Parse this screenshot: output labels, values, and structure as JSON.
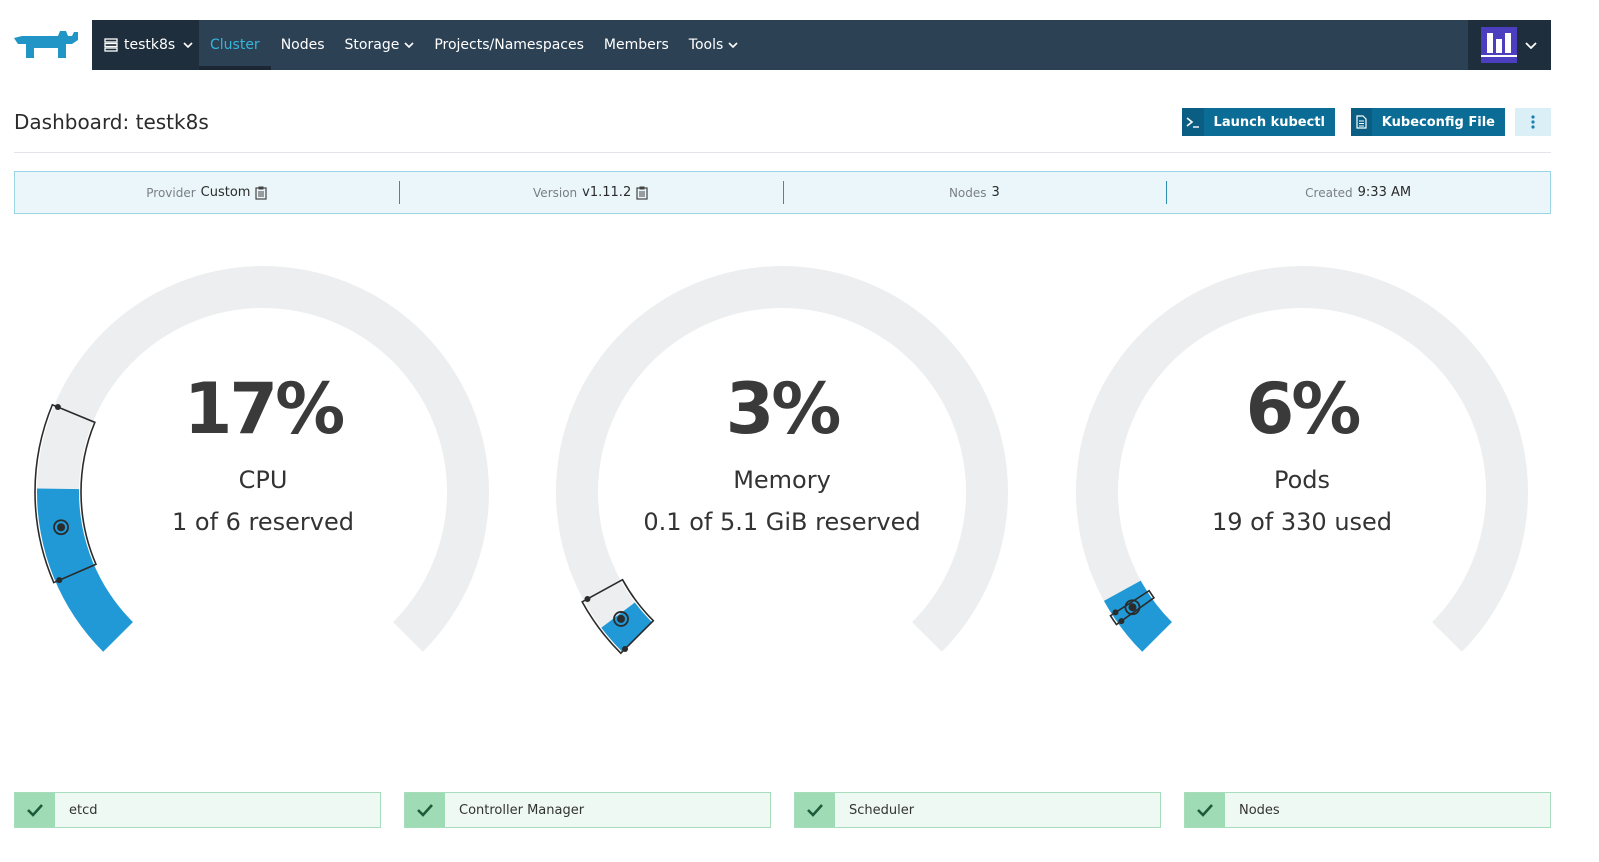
{
  "nav": {
    "cluster": "testk8s",
    "items": [
      {
        "label": "Cluster",
        "active": true,
        "dropdown": false
      },
      {
        "label": "Nodes",
        "active": false,
        "dropdown": false
      },
      {
        "label": "Storage",
        "active": false,
        "dropdown": true
      },
      {
        "label": "Projects/Namespaces",
        "active": false,
        "dropdown": false
      },
      {
        "label": "Members",
        "active": false,
        "dropdown": false
      },
      {
        "label": "Tools",
        "active": false,
        "dropdown": true
      }
    ]
  },
  "header": {
    "title": "Dashboard: testk8s",
    "launch_kubectl": "Launch kubectl",
    "kubeconfig": "Kubeconfig File"
  },
  "info": [
    {
      "label": "Provider",
      "value": "Custom",
      "copy": true
    },
    {
      "label": "Version",
      "value": "v1.11.2",
      "copy": true
    },
    {
      "label": "Nodes",
      "value": "3",
      "copy": false
    },
    {
      "label": "Created",
      "value": "9:33 AM",
      "copy": false
    }
  ],
  "gauges": [
    {
      "percent": "17%",
      "title": "CPU",
      "subtitle": "1 of 6 reserved",
      "used_fraction": 0.17,
      "reserved_range": [
        0.08,
        0.25
      ],
      "marker": 0.13
    },
    {
      "percent": "3%",
      "title": "Memory",
      "subtitle": "0.1 of 5.1 GiB reserved",
      "used_fraction": 0.03,
      "reserved_range": [
        0.0,
        0.06
      ],
      "marker": 0.025
    },
    {
      "percent": "6%",
      "title": "Pods",
      "subtitle": "19 of 330 used",
      "used_fraction": 0.06,
      "reserved_range": [
        0.035,
        0.045
      ],
      "marker": 0.04
    }
  ],
  "status": [
    {
      "label": "etcd"
    },
    {
      "label": "Controller Manager"
    },
    {
      "label": "Scheduler"
    },
    {
      "label": "Nodes"
    }
  ],
  "colors": {
    "nav_bg": "#2d4155",
    "accent": "#35b6d9",
    "button": "#0b6c95",
    "gauge_fill": "#2199d6",
    "gauge_track": "#eceeef",
    "status_ok": "#9fdcb6"
  }
}
